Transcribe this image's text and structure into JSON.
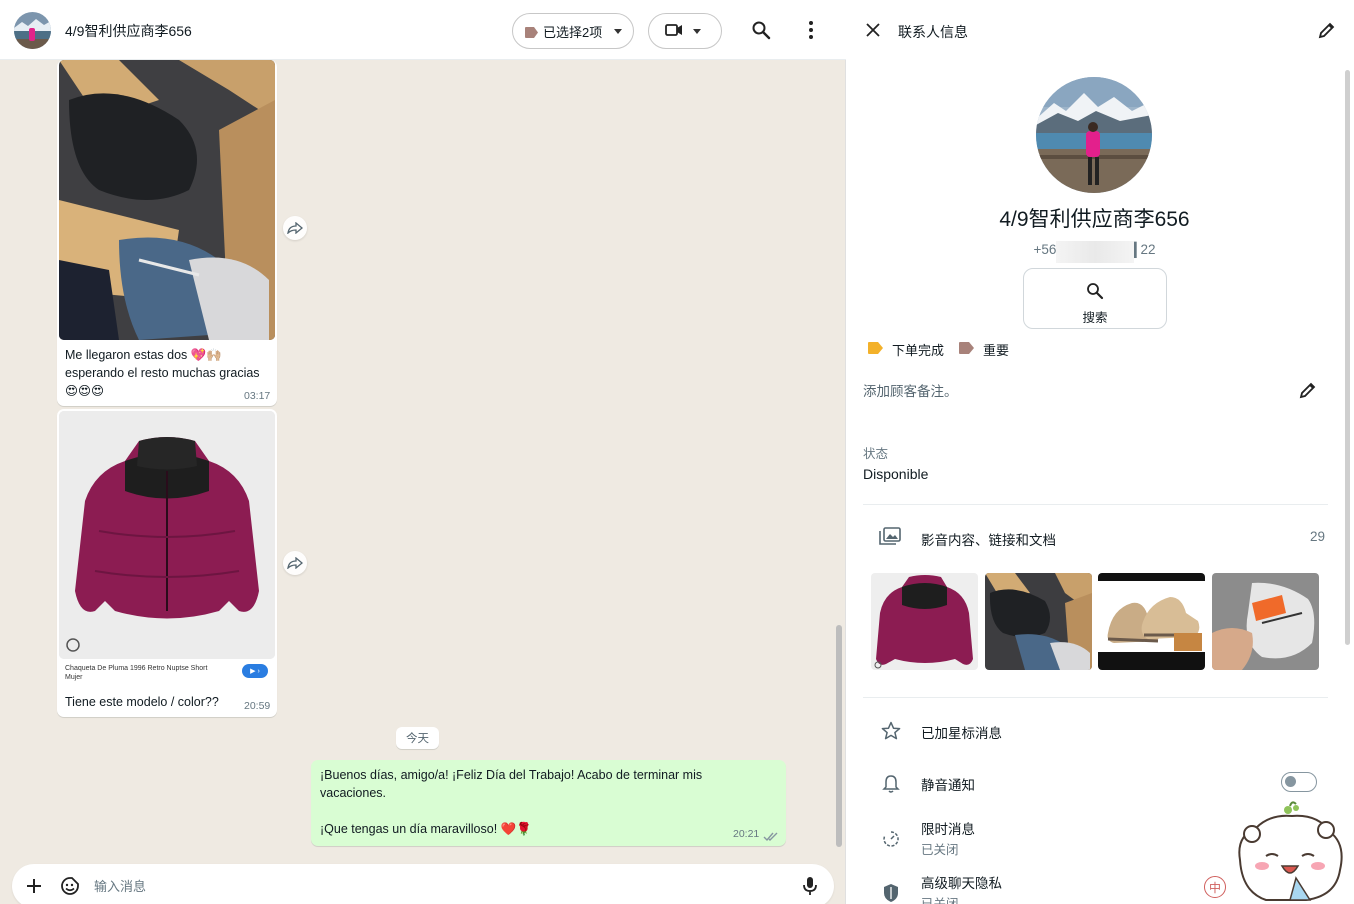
{
  "chat": {
    "title": "4/9智利供应商李656",
    "labels_filter": "已选择2项",
    "messages_in": [
      {
        "text_line1": "Me llegaron estas dos 💖🙌🏼",
        "text_line2": "esperando el resto muchas gracias",
        "emoji_line": "😍😍😍",
        "time": "03:17"
      },
      {
        "link_title": "Chaqueta De Pluma 1996 Retro Nuptse Short Mujer",
        "link_tag": "▶ ›",
        "text": "Tiene este modelo / color??",
        "time": "20:59"
      }
    ],
    "day_divider": "今天",
    "message_out": {
      "line1": "¡Buenos días, amigo/a! ¡Feliz Día del Trabajo! Acabo de terminar mis",
      "line2": "vacaciones.",
      "line3": "¡Que tengas un día maravilloso! ❤️🌹",
      "time": "20:21"
    },
    "composer_placeholder": "输入消息"
  },
  "contact": {
    "header_title": "联系人信息",
    "name": "4/9智利供应商李656",
    "phone": "+56 ████████ 22",
    "search_label": "搜索",
    "labels": [
      {
        "name": "下单完成",
        "color": "#f3b12a"
      },
      {
        "name": "重要",
        "color": "#a8827a"
      }
    ],
    "note_placeholder": "添加顾客备注。",
    "status_heading": "状态",
    "status_value": "Disponible",
    "media_label": "影音内容、链接和文档",
    "media_count": "29",
    "starred_label": "已加星标消息",
    "mute_label": "静音通知",
    "mute_enabled": false,
    "disappearing_label": "限时消息",
    "disappearing_value": "已关闭",
    "privacy_label": "高级聊天隐私",
    "privacy_value": "已关闭",
    "ime_badge": "中"
  },
  "colors": {
    "chat_bg": "#efeae2",
    "outgoing_bubble": "#d9fdd3",
    "incoming_bubble": "#ffffff",
    "read_check": "#8696a0"
  }
}
